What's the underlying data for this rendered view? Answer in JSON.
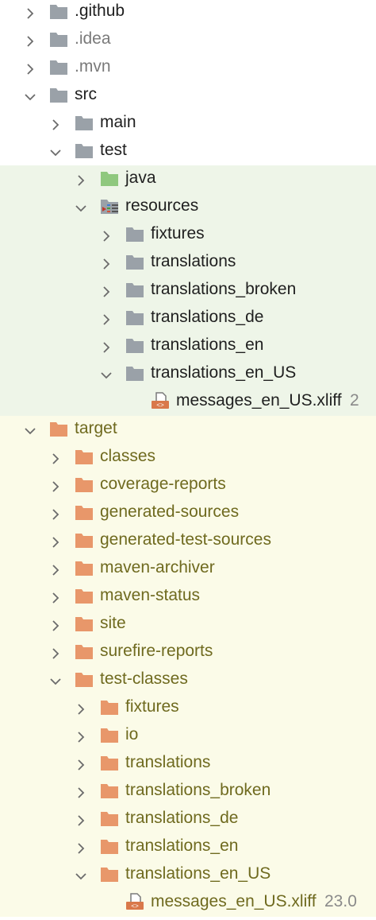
{
  "colors": {
    "folder_gray": "#9aa1a8",
    "folder_green": "#8fc87e",
    "folder_orange": "#e8976a",
    "excluded_text": "#6f6a1f",
    "test_band": "#eef5e8",
    "excluded_band": "#fbfbe8"
  },
  "tree": [
    {
      "label": ".github",
      "depth": 0,
      "state": "collapsed",
      "icon": "folder-gray",
      "style": "normal"
    },
    {
      "label": ".idea",
      "depth": 0,
      "state": "collapsed",
      "icon": "folder-gray",
      "style": "dim"
    },
    {
      "label": ".mvn",
      "depth": 0,
      "state": "collapsed",
      "icon": "folder-gray",
      "style": "dim"
    },
    {
      "label": "src",
      "depth": 0,
      "state": "expanded",
      "icon": "folder-gray",
      "style": "normal"
    },
    {
      "label": "main",
      "depth": 1,
      "state": "collapsed",
      "icon": "folder-gray",
      "style": "normal"
    },
    {
      "label": "test",
      "depth": 1,
      "state": "expanded",
      "icon": "folder-gray",
      "style": "normal"
    },
    {
      "label": "java",
      "depth": 2,
      "state": "collapsed",
      "icon": "folder-green",
      "style": "normal",
      "band": "green"
    },
    {
      "label": "resources",
      "depth": 2,
      "state": "expanded",
      "icon": "resources-folder",
      "style": "normal",
      "band": "green"
    },
    {
      "label": "fixtures",
      "depth": 3,
      "state": "collapsed",
      "icon": "folder-gray",
      "style": "normal",
      "band": "green"
    },
    {
      "label": "translations",
      "depth": 3,
      "state": "collapsed",
      "icon": "folder-gray",
      "style": "normal",
      "band": "green"
    },
    {
      "label": "translations_broken",
      "depth": 3,
      "state": "collapsed",
      "icon": "folder-gray",
      "style": "normal",
      "band": "green"
    },
    {
      "label": "translations_de",
      "depth": 3,
      "state": "collapsed",
      "icon": "folder-gray",
      "style": "normal",
      "band": "green"
    },
    {
      "label": "translations_en",
      "depth": 3,
      "state": "collapsed",
      "icon": "folder-gray",
      "style": "normal",
      "band": "green"
    },
    {
      "label": "translations_en_US",
      "depth": 3,
      "state": "expanded",
      "icon": "folder-gray",
      "style": "normal",
      "band": "green"
    },
    {
      "label": "messages_en_US.xliff",
      "depth": 4,
      "state": "file",
      "icon": "xliff-file",
      "style": "normal",
      "band": "green",
      "meta": "2"
    },
    {
      "label": "target",
      "depth": 0,
      "state": "expanded",
      "icon": "folder-orange",
      "style": "target",
      "band": "yellow"
    },
    {
      "label": "classes",
      "depth": 1,
      "state": "collapsed",
      "icon": "folder-orange",
      "style": "target",
      "band": "yellow"
    },
    {
      "label": "coverage-reports",
      "depth": 1,
      "state": "collapsed",
      "icon": "folder-orange",
      "style": "target",
      "band": "yellow"
    },
    {
      "label": "generated-sources",
      "depth": 1,
      "state": "collapsed",
      "icon": "folder-orange",
      "style": "target",
      "band": "yellow"
    },
    {
      "label": "generated-test-sources",
      "depth": 1,
      "state": "collapsed",
      "icon": "folder-orange",
      "style": "target",
      "band": "yellow"
    },
    {
      "label": "maven-archiver",
      "depth": 1,
      "state": "collapsed",
      "icon": "folder-orange",
      "style": "target",
      "band": "yellow"
    },
    {
      "label": "maven-status",
      "depth": 1,
      "state": "collapsed",
      "icon": "folder-orange",
      "style": "target",
      "band": "yellow"
    },
    {
      "label": "site",
      "depth": 1,
      "state": "collapsed",
      "icon": "folder-orange",
      "style": "target",
      "band": "yellow"
    },
    {
      "label": "surefire-reports",
      "depth": 1,
      "state": "collapsed",
      "icon": "folder-orange",
      "style": "target",
      "band": "yellow"
    },
    {
      "label": "test-classes",
      "depth": 1,
      "state": "expanded",
      "icon": "folder-orange",
      "style": "target",
      "band": "yellow"
    },
    {
      "label": "fixtures",
      "depth": 2,
      "state": "collapsed",
      "icon": "folder-orange",
      "style": "target",
      "band": "yellow"
    },
    {
      "label": "io",
      "depth": 2,
      "state": "collapsed",
      "icon": "folder-orange",
      "style": "target",
      "band": "yellow"
    },
    {
      "label": "translations",
      "depth": 2,
      "state": "collapsed",
      "icon": "folder-orange",
      "style": "target",
      "band": "yellow"
    },
    {
      "label": "translations_broken",
      "depth": 2,
      "state": "collapsed",
      "icon": "folder-orange",
      "style": "target",
      "band": "yellow"
    },
    {
      "label": "translations_de",
      "depth": 2,
      "state": "collapsed",
      "icon": "folder-orange",
      "style": "target",
      "band": "yellow"
    },
    {
      "label": "translations_en",
      "depth": 2,
      "state": "collapsed",
      "icon": "folder-orange",
      "style": "target",
      "band": "yellow"
    },
    {
      "label": "translations_en_US",
      "depth": 2,
      "state": "expanded",
      "icon": "folder-orange",
      "style": "target",
      "band": "yellow"
    },
    {
      "label": "messages_en_US.xliff",
      "depth": 3,
      "state": "file",
      "icon": "xliff-file",
      "style": "target",
      "band": "yellow",
      "meta": "23.0"
    }
  ]
}
